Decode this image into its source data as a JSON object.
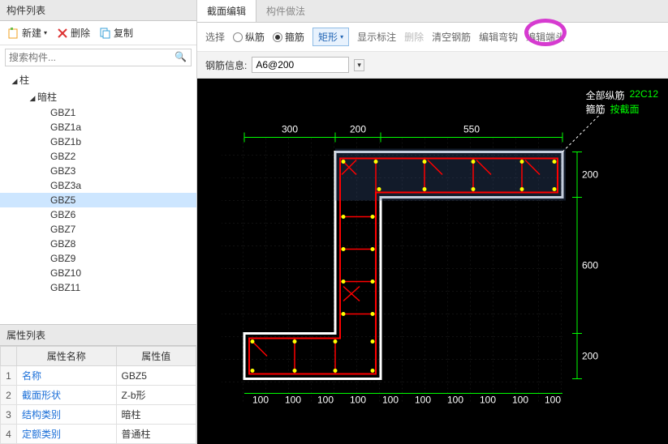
{
  "left": {
    "title": "构件列表",
    "toolbar": {
      "new": "新建",
      "del": "删除",
      "copy": "复制"
    },
    "search_placeholder": "搜索构件...",
    "tree": {
      "root": "柱",
      "sub": "暗柱",
      "items": [
        "GBZ1",
        "GBZ1a",
        "GBZ1b",
        "GBZ2",
        "GBZ3",
        "GBZ3a",
        "GBZ5",
        "GBZ6",
        "GBZ7",
        "GBZ8",
        "GBZ9",
        "GBZ10",
        "GBZ11"
      ],
      "selected": "GBZ5"
    }
  },
  "props": {
    "title": "属性列表",
    "cols": {
      "name": "属性名称",
      "val": "属性值"
    },
    "rows": [
      {
        "idx": "1",
        "name": "名称",
        "val": "GBZ5"
      },
      {
        "idx": "2",
        "name": "截面形状",
        "val": "Z-b形"
      },
      {
        "idx": "3",
        "name": "结构类别",
        "val": "暗柱"
      },
      {
        "idx": "4",
        "name": "定额类别",
        "val": "普通柱"
      }
    ]
  },
  "right": {
    "tabs": {
      "a": "截面编辑",
      "b": "构件做法"
    },
    "toolbar": {
      "select": "选择",
      "radio1": "纵筋",
      "radio2": "箍筋",
      "shape_btn": "矩形",
      "show_anno": "显示标注",
      "del": "删除",
      "clear": "清空钢筋",
      "edit_hook": "编辑弯钩",
      "edit_end": "编辑端头"
    },
    "info": {
      "label": "钢筋信息:",
      "value": "A6@200"
    },
    "legend": {
      "a1": "全部纵筋",
      "a2": "22C12",
      "b1": "箍筋",
      "b2": "按截面"
    },
    "dims": {
      "top_a": "300",
      "top_b": "200",
      "top_c": "550",
      "r1": "200",
      "r2": "600",
      "r3": "200",
      "bot": [
        "100",
        "100",
        "100",
        "100",
        "100",
        "100",
        "100",
        "100",
        "100",
        "100"
      ]
    }
  }
}
